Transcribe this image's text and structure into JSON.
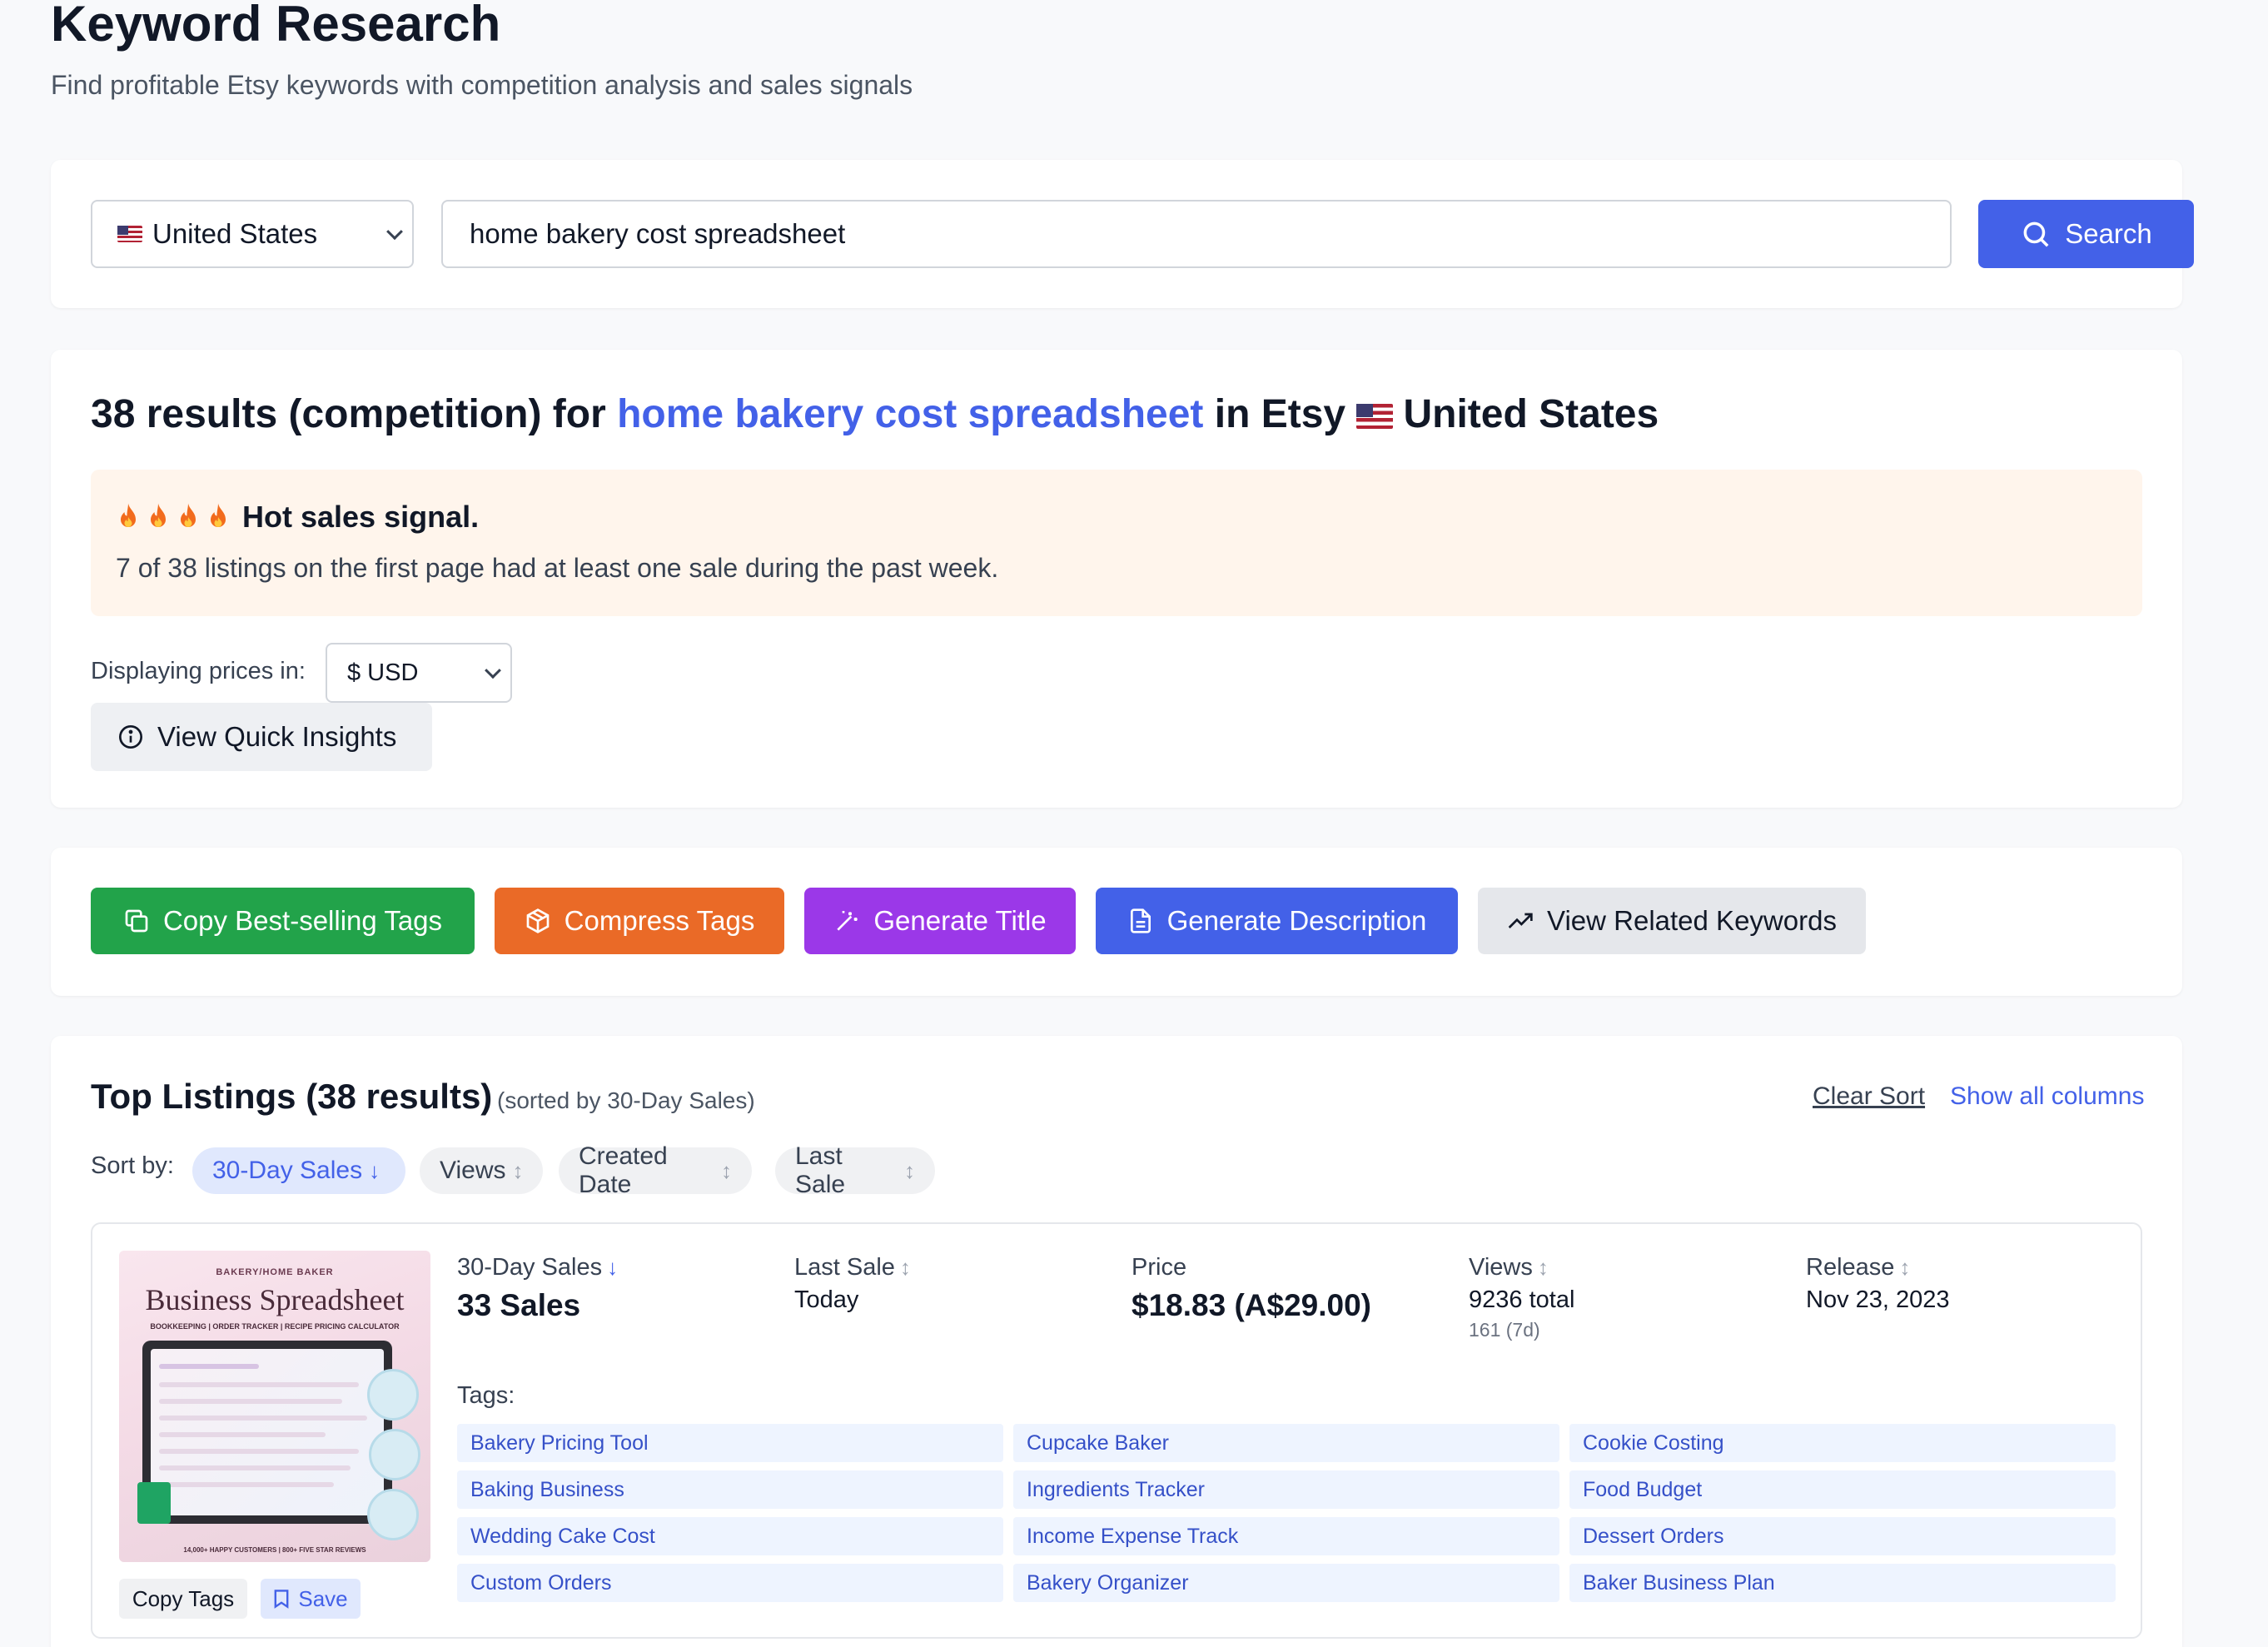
{
  "header": {
    "title": "Keyword Research",
    "subtitle": "Find profitable Etsy keywords with competition analysis and sales signals"
  },
  "search": {
    "country": "United States",
    "query": "home bakery cost spreadsheet",
    "button_label": "Search"
  },
  "results": {
    "count_text": "38 results (competition) for",
    "keyword": "home bakery cost spreadsheet",
    "in_text": "in Etsy",
    "country": "United States",
    "signal_title": "Hot sales signal.",
    "signal_text": "7 of 38 listings on the first page had at least one sale during the past week.",
    "prices_label": "Displaying prices in:",
    "currency": "$ USD",
    "insights_label": "View Quick Insights"
  },
  "actions": {
    "copy_tags": "Copy Best-selling Tags",
    "compress_tags": "Compress Tags",
    "generate_title": "Generate Title",
    "generate_description": "Generate Description",
    "related_keywords": "View Related Keywords"
  },
  "listings": {
    "title": "Top Listings (38 results)",
    "sorted_by": "(sorted by 30-Day Sales)",
    "clear_sort": "Clear Sort",
    "show_columns": "Show all columns",
    "sort_label": "Sort by:",
    "sort_options": [
      "30-Day Sales",
      "Views",
      "Created Date",
      "Last Sale"
    ],
    "items": [
      {
        "image_text_top": "BAKERY/HOME BAKER",
        "image_text_title": "Business Spreadsheet",
        "image_text_sub": "BOOKKEEPING | ORDER TRACKER | RECIPE PRICING CALCULATOR",
        "image_text_foot": "14,000+ HAPPY CUSTOMERS | 800+ FIVE STAR REVIEWS",
        "sales_label": "30-Day Sales",
        "sales_value": "33 Sales",
        "last_sale_label": "Last Sale",
        "last_sale_value": "Today",
        "price_label": "Price",
        "price_value": "$18.83 (A$29.00)",
        "views_label": "Views",
        "views_total": "9236 total",
        "views_7d": "161 (7d)",
        "release_label": "Release",
        "release_value": "Nov 23, 2023",
        "tags_label": "Tags:",
        "tags": [
          "Bakery Pricing Tool",
          "Cupcake Baker",
          "Cookie Costing",
          "Baking Business",
          "Ingredients Tracker",
          "Food Budget",
          "Wedding Cake Cost",
          "Income Expense Track",
          "Dessert Orders",
          "Custom Orders",
          "Bakery Organizer",
          "Baker Business Plan"
        ],
        "copy_tags_label": "Copy Tags",
        "save_label": "Save"
      }
    ]
  },
  "colors": {
    "accent": "#4361e8",
    "green": "#22a34a",
    "orange": "#ea6a27",
    "purple": "#9b38e8",
    "signal_bg": "#fff5ec"
  }
}
